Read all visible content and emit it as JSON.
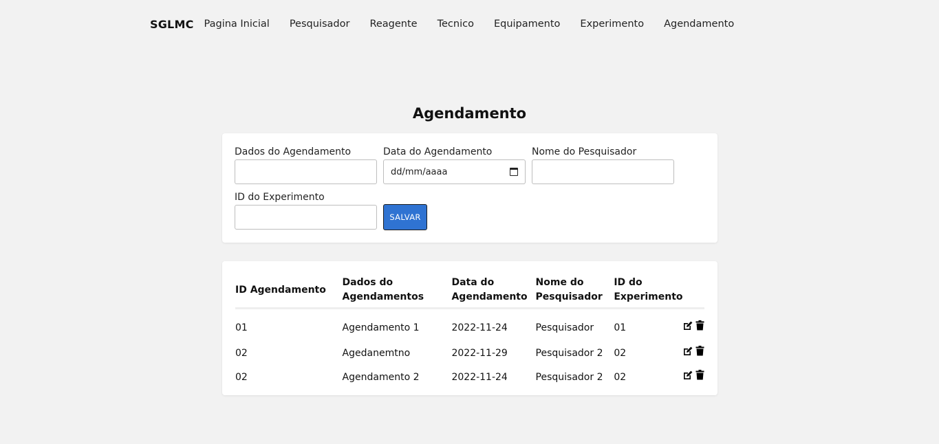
{
  "nav": {
    "brand": "SGLMC",
    "links": [
      "Pagina Inicial",
      "Pesquisador",
      "Reagente",
      "Tecnico",
      "Equipamento",
      "Experimento",
      "Agendamento"
    ]
  },
  "page": {
    "title": "Agendamento"
  },
  "form": {
    "dados_label": "Dados do Agendamento",
    "dados_value": "",
    "data_label": "Data do Agendamento",
    "data_placeholder": "dd/mm/aaaa",
    "nome_label": "Nome do Pesquisador",
    "nome_value": "",
    "id_exp_label": "ID do Experimento",
    "id_exp_value": "",
    "save_label": "SALVAR"
  },
  "table": {
    "headers": [
      "ID Agendamento",
      "Dados do Agendamentos",
      "Data do Agendamento",
      "Nome do Pesquisador",
      "ID do Experimento"
    ],
    "header_lines": [
      [
        "ID Agendamento"
      ],
      [
        "Dados do",
        "Agendamentos"
      ],
      [
        "Data do",
        "Agendamento"
      ],
      [
        "Nome do",
        "Pesquisador"
      ],
      [
        "ID do",
        "Experimento"
      ]
    ],
    "rows": [
      [
        "01",
        "Agendamento 1",
        "2022-11-24",
        "Pesquisador",
        "01"
      ],
      [
        "02",
        "Agedanemtno",
        "2022-11-29",
        "Pesquisador 2",
        "02"
      ],
      [
        "02",
        "Agendamento 2",
        "2022-11-24",
        "Pesquisador 2",
        "02"
      ]
    ]
  },
  "icons": {
    "edit": "edit-icon",
    "delete": "trash-icon"
  },
  "colors": {
    "background": "#f2f2f2",
    "card": "#ffffff",
    "accent": "#2f73d2"
  }
}
